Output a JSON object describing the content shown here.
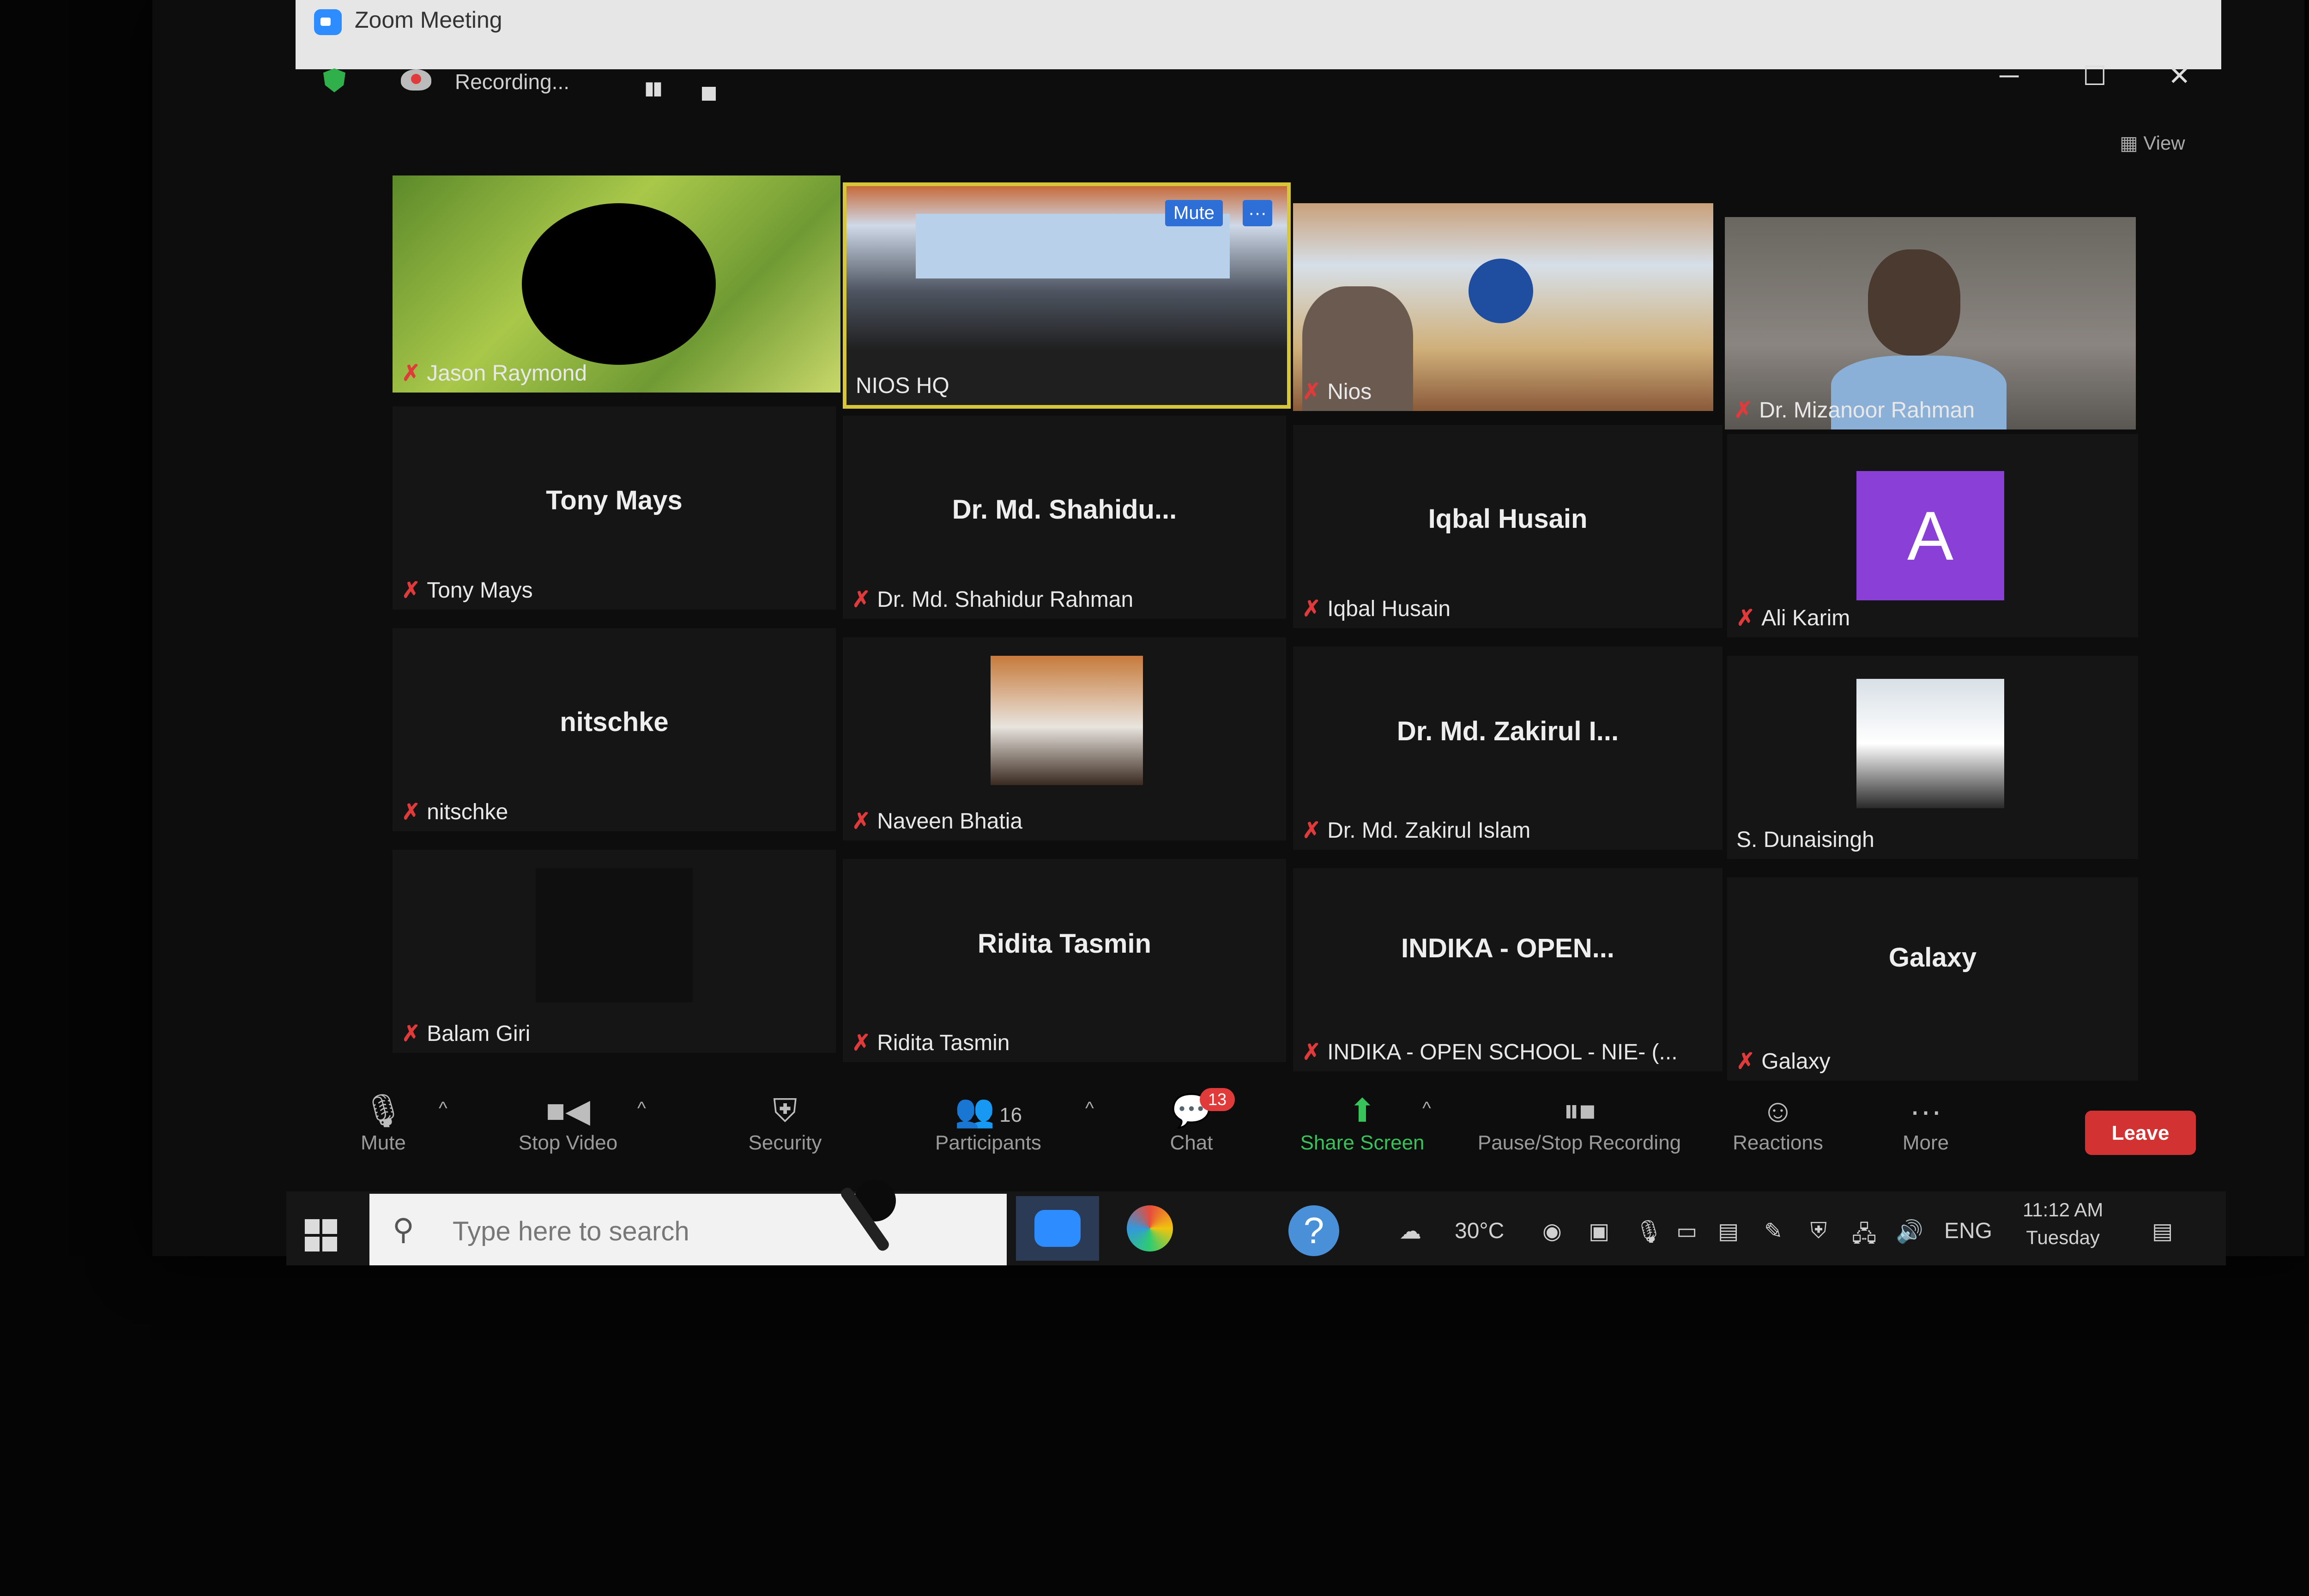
{
  "window": {
    "title": "Zoom Meeting"
  },
  "recording": {
    "status": "Recording...",
    "pause": "▮▮"
  },
  "view_label": "View",
  "tiles": [
    {
      "name": "Jason Raymond"
    },
    {
      "name": "NIOS HQ",
      "overlay_mute": "Mute",
      "overlay_more": "···"
    },
    {
      "name": "Nios"
    },
    {
      "name": "Dr. Mizanoor Rahman"
    },
    {
      "name": "Tony Mays",
      "center": "Tony Mays"
    },
    {
      "name": "Dr. Md. Shahidur Rahman",
      "center": "Dr. Md. Shahidu..."
    },
    {
      "name": "Iqbal Husain",
      "center": "Iqbal Husain"
    },
    {
      "name": "Ali Karim",
      "avatar": "A",
      "avatar_color": "#8a3fd6"
    },
    {
      "name": "nitschke",
      "center": "nitschke"
    },
    {
      "name": "Naveen Bhatia"
    },
    {
      "name": "Dr. Md. Zakirul Islam",
      "center": "Dr. Md. Zakirul I..."
    },
    {
      "name": "S. Dunaisingh"
    },
    {
      "name": "Balam Giri"
    },
    {
      "name": "Ridita Tasmin",
      "center": "Ridita Tasmin"
    },
    {
      "name": "INDIKA - OPEN SCHOOL - NIE- (...",
      "center": "INDIKA - OPEN..."
    },
    {
      "name": "Galaxy",
      "center": "Galaxy"
    }
  ],
  "toolbar": {
    "mute": "Mute",
    "stop_video": "Stop Video",
    "security": "Security",
    "participants": "Participants",
    "participants_count": "16",
    "chat": "Chat",
    "chat_badge": "13",
    "share_screen": "Share Screen",
    "pause_stop_recording": "Pause/Stop Recording",
    "reactions": "Reactions",
    "more": "More",
    "leave": "Leave"
  },
  "taskbar": {
    "search_placeholder": "Type here to search",
    "temperature": "30°C",
    "language": "ENG",
    "time": "11:12 AM",
    "day": "Tuesday"
  }
}
